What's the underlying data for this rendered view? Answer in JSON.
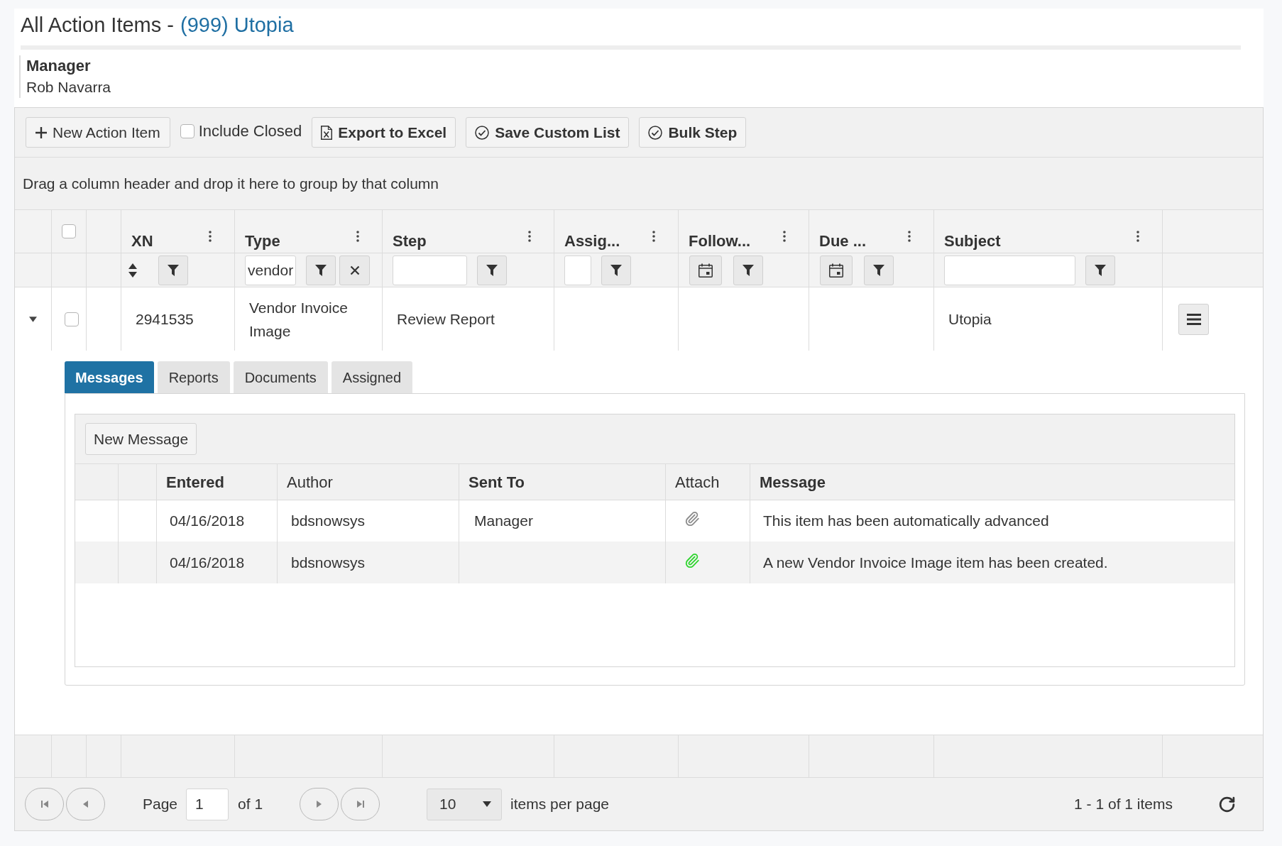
{
  "page_header": {
    "title": "All Action Items -",
    "link": "(999) Utopia"
  },
  "assignee": {
    "role": "Manager",
    "name": "Rob Navarra"
  },
  "toolbar": [
    {
      "kind": "add",
      "label": "New Action Item"
    },
    {
      "kind": "toggle",
      "label": "Include Closed",
      "checked": false
    },
    {
      "kind": "export",
      "label": "Export to Excel"
    },
    {
      "kind": "confirm",
      "label": "Save Custom List"
    },
    {
      "kind": "confirm",
      "label": "Bulk Step"
    }
  ],
  "group_panel": {
    "hint": "Drag a column header and drop it here to group by that column"
  },
  "grid": {
    "select_all": {
      "checked": false
    },
    "columns": [
      {
        "label": "XN",
        "filter": {
          "kind": "numeric"
        }
      },
      {
        "label": "Type",
        "filter": {
          "kind": "text",
          "value": "vendor",
          "clearable": true
        }
      },
      {
        "label": "Step",
        "filter": {
          "kind": "text",
          "clearable": false
        }
      },
      {
        "label": "Assig...",
        "filter": {
          "kind": "text",
          "clearable": false
        }
      },
      {
        "label": "Follow...",
        "filter": {
          "kind": "date"
        }
      },
      {
        "label": "Due ...",
        "filter": {
          "kind": "date"
        }
      },
      {
        "label": "Subject",
        "filter": {
          "kind": "text",
          "clearable": false
        }
      }
    ],
    "rows": [
      {
        "expanded": true,
        "checked": false,
        "cells": {
          "xn": "2941535",
          "type": "Vendor Invoice Image",
          "step": "Review Report",
          "subject": "Utopia"
        },
        "detail": {
          "tabs": [
            {
              "label": "Messages",
              "selected": true
            },
            {
              "label": "Reports",
              "selected": false
            },
            {
              "label": "Documents",
              "selected": false
            },
            {
              "label": "Assigned",
              "selected": false
            }
          ],
          "messages": {
            "new_button": "New Message",
            "columns": [
              {
                "label": "Entered",
                "bold": true
              },
              {
                "label": "Author",
                "bold": false
              },
              {
                "label": "Sent To",
                "bold": true
              },
              {
                "label": "Attach",
                "bold": false
              },
              {
                "label": "Message",
                "bold": true
              }
            ],
            "rows": [
              {
                "entered": "04/16/2018",
                "author": "bdsnowsys",
                "sent_to": "Manager",
                "color": "#8c8c8c",
                "message": "This item has been automatically advanced"
              },
              {
                "entered": "04/16/2018",
                "author": "bdsnowsys",
                "color": "#2fd52f",
                "message": "A new Vendor Invoice Image item has been created."
              }
            ]
          }
        }
      }
    ],
    "pager": {
      "page_label": "Page",
      "page": "1",
      "total_label": "of 1",
      "page_size": "10",
      "page_size_label": "items per page",
      "summary": "1 - 1 of 1 items"
    }
  }
}
